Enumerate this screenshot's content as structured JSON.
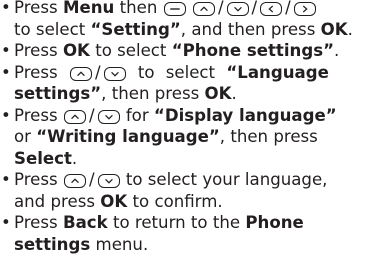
{
  "steps": [
    {
      "p1": "Press ",
      "b1": "Menu",
      "p2": " then ",
      "p3": " to select ",
      "b2": "“Setting”",
      "p4": ", and then press ",
      "b3": "OK",
      "p5": "."
    },
    {
      "p1": "Press ",
      "b1": "OK",
      "p2": " to select ",
      "b2": "“Phone settings”",
      "p3": "."
    },
    {
      "p1": "Press ",
      "p2": " to select ",
      "b1": "“Language",
      "b2": "settings”",
      "p3": ", then press ",
      "b3": "OK",
      "p4": "."
    },
    {
      "p1": "Press ",
      "p2": " for ",
      "b1": "“Display language”",
      "p3": "or ",
      "b2": "“Writing language”",
      "p4": ", then press",
      "b3": "Select",
      "p5": "."
    },
    {
      "p1": "Press ",
      "p2": " to select your language,",
      "p3": "and press ",
      "b1": "OK",
      "p4": " to confirm."
    },
    {
      "p1": "Press ",
      "b1": "Back",
      "p2": " to return to the ",
      "b2": "Phone",
      "b3": "settings",
      "p3": " menu."
    }
  ],
  "icons": {
    "menu_key": "menu-key-icon",
    "up_key": "up-key-icon",
    "down_key": "down-key-icon",
    "left_key": "left-key-icon",
    "right_key": "right-key-icon"
  },
  "separator": "/",
  "bullet": "•"
}
